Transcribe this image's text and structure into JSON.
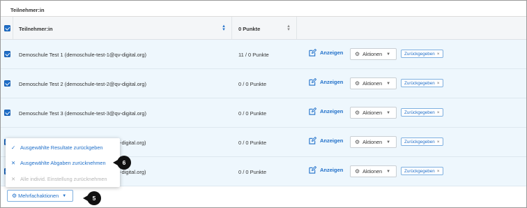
{
  "section": {
    "title": "Teilnehmer:in"
  },
  "table": {
    "columns": {
      "participant": "Teilnehmer:in",
      "points": "0 Punkte"
    },
    "rows": [
      {
        "name": "Demoschule Test 1 (demoschule-test-1@qv-digital.org)",
        "points": "11 / 0 Punkte",
        "view_label": "Anzeigen",
        "actions_label": "Aktionen",
        "tag": "Zurückgegeben"
      },
      {
        "name": "Demoschule Test 2 (demoschule-test-2@qv-digital.org)",
        "points": "0 / 0 Punkte",
        "view_label": "Anzeigen",
        "actions_label": "Aktionen",
        "tag": "Zurückgegeben"
      },
      {
        "name": "Demoschule Test 3 (demoschule-test-3@qv-digital.org)",
        "points": "0 / 0 Punkte",
        "view_label": "Anzeigen",
        "actions_label": "Aktionen",
        "tag": "Zurückgegeben"
      },
      {
        "name_suffix": "-digital.org)",
        "points": "0 / 0 Punkte",
        "view_label": "Anzeigen",
        "actions_label": "Aktionen",
        "tag": "Zurückgegeben"
      },
      {
        "name_suffix": "-digital.org)",
        "points": "0 / 0 Punkte",
        "view_label": "Anzeigen",
        "actions_label": "Aktionen",
        "tag": "Zurückgegeben"
      }
    ]
  },
  "bulk_menu": {
    "items": [
      {
        "icon": "check-icon",
        "label": "Ausgewählte Resultate zurückgeben",
        "enabled": true
      },
      {
        "icon": "close-icon",
        "label": "Ausgewählte Abgaben zurücknehmen",
        "enabled": true
      },
      {
        "icon": "close-icon",
        "label": "Alle individ. Einstellung zurücknehmen",
        "enabled": false
      }
    ],
    "button_label": "Mehrfachaktionen"
  },
  "callouts": {
    "menu_item": "6",
    "bulk_button": "5"
  },
  "colors": {
    "accent": "#1f6fc9",
    "row_bg": "#eef7fd",
    "header_bg": "#f4f6f8",
    "tag_border": "#7fb0e0",
    "disabled": "#b5b5b5",
    "badge": "#111111"
  }
}
